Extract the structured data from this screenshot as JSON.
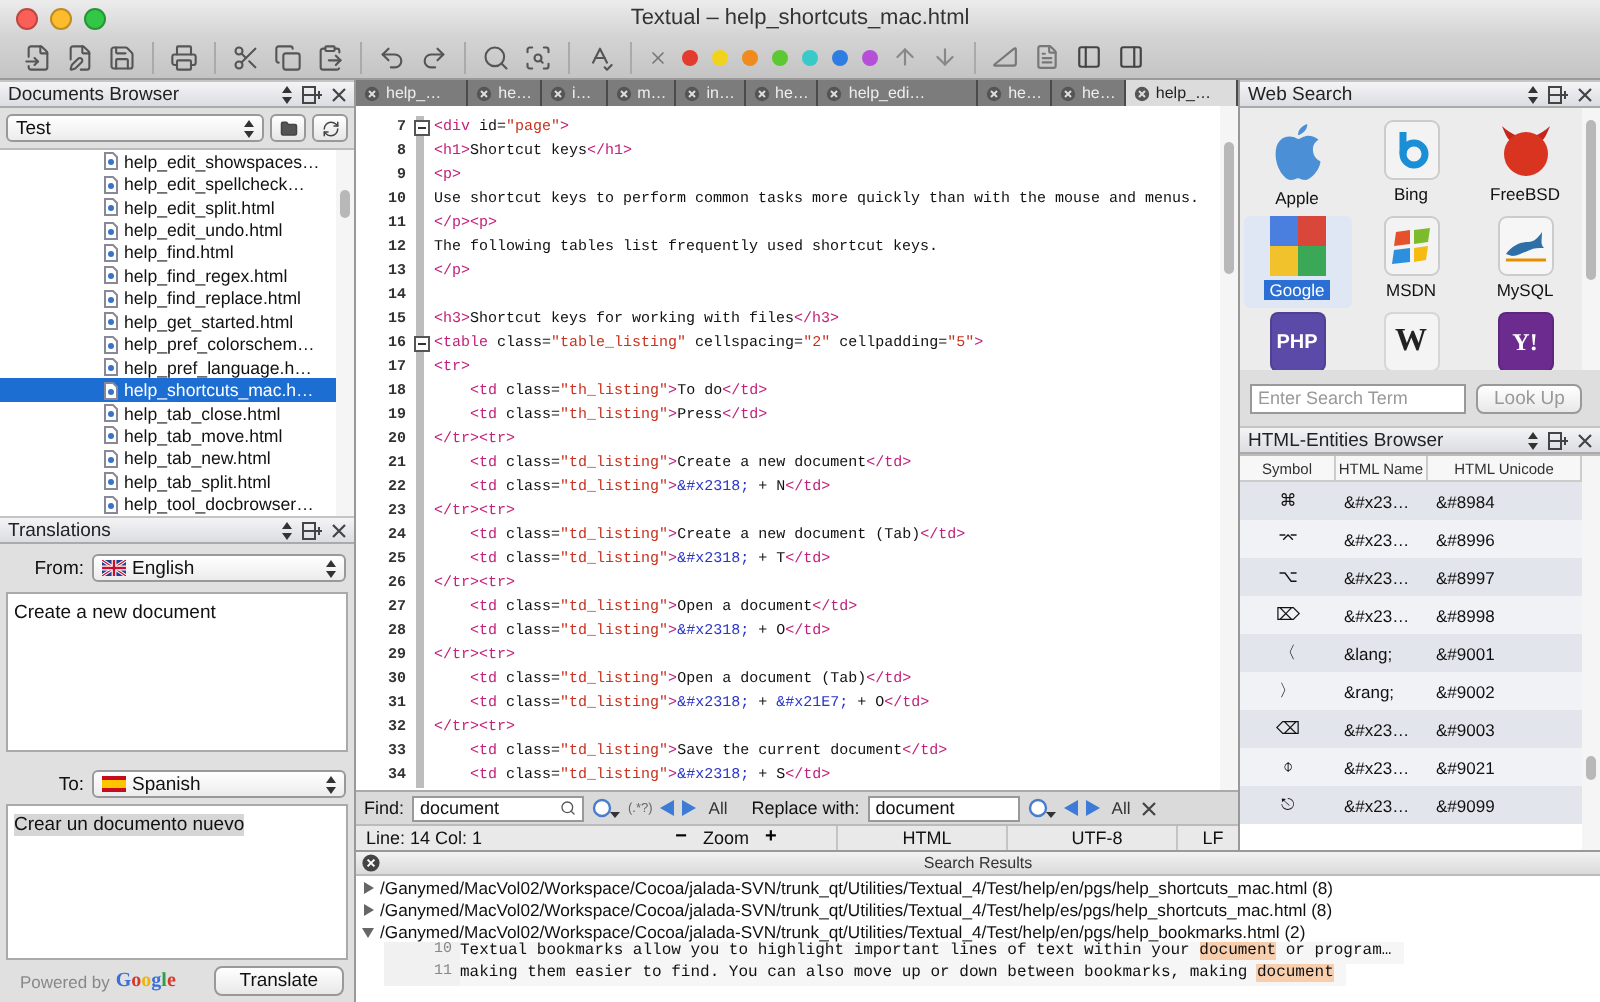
{
  "window": {
    "title": "Textual – help_shortcuts_mac.html"
  },
  "toolbar": {
    "bookmark_colors": [
      {
        "color": "#e33b2e"
      },
      {
        "color": "#f2d31b"
      },
      {
        "color": "#f08a1c"
      },
      {
        "color": "#5cc932"
      },
      {
        "color": "#38c9c9"
      },
      {
        "color": "#2f7de0"
      },
      {
        "color": "#b64fd8"
      }
    ]
  },
  "documents_browser": {
    "title": "Documents Browser",
    "folder": "Test",
    "files": [
      {
        "name": "help_edit_showspaces…",
        "selected": false
      },
      {
        "name": "help_edit_spellcheck…",
        "selected": false
      },
      {
        "name": "help_edit_split.html",
        "selected": false
      },
      {
        "name": "help_edit_undo.html",
        "selected": false
      },
      {
        "name": "help_find.html",
        "selected": false
      },
      {
        "name": "help_find_regex.html",
        "selected": false
      },
      {
        "name": "help_find_replace.html",
        "selected": false
      },
      {
        "name": "help_get_started.html",
        "selected": false
      },
      {
        "name": "help_pref_colorschem…",
        "selected": false
      },
      {
        "name": "help_pref_language.h…",
        "selected": false
      },
      {
        "name": "help_shortcuts_mac.h…",
        "selected": true
      },
      {
        "name": "help_tab_close.html",
        "selected": false
      },
      {
        "name": "help_tab_move.html",
        "selected": false
      },
      {
        "name": "help_tab_new.html",
        "selected": false
      },
      {
        "name": "help_tab_split.html",
        "selected": false
      },
      {
        "name": "help_tool_docbrowser…",
        "selected": false
      }
    ]
  },
  "translations": {
    "title": "Translations",
    "from_label": "From:",
    "from_language": "English",
    "source_text": "Create a new document",
    "to_label": "To:",
    "to_language": "Spanish",
    "result_text": "Crear un documento nuevo",
    "powered_by": "Powered by",
    "logo": "Google",
    "button": "Translate"
  },
  "tabs": [
    {
      "label": "help_…",
      "selected": false
    },
    {
      "label": "he…",
      "selected": false
    },
    {
      "label": "i…",
      "selected": false
    },
    {
      "label": "m…",
      "selected": false
    },
    {
      "label": "in…",
      "selected": false
    },
    {
      "label": "he…",
      "selected": false
    },
    {
      "label": "help_edi…",
      "selected": false
    },
    {
      "label": "he…",
      "selected": false
    },
    {
      "label": "he…",
      "selected": false
    },
    {
      "label": "help_…",
      "selected": true
    }
  ],
  "editor": {
    "lines": [
      {
        "number": "7",
        "fold": true,
        "tokens": [
          {
            "kind": "tag",
            "t": "<div"
          },
          {
            "kind": "text",
            "t": " id="
          },
          {
            "kind": "str",
            "t": "\"page\""
          },
          {
            "kind": "tag",
            "t": ">"
          }
        ]
      },
      {
        "number": "8",
        "fold": false,
        "tokens": [
          {
            "kind": "tag",
            "t": "<h1>"
          },
          {
            "kind": "text",
            "t": "Shortcut keys"
          },
          {
            "kind": "tag",
            "t": "</h1>"
          }
        ]
      },
      {
        "number": "9",
        "fold": false,
        "tokens": [
          {
            "kind": "tag",
            "t": "<p>"
          }
        ]
      },
      {
        "number": "10",
        "fold": false,
        "tokens": [
          {
            "kind": "text",
            "t": "Use shortcut keys to perform common tasks more quickly than with the mouse and menus."
          }
        ]
      },
      {
        "number": "11",
        "fold": false,
        "tokens": [
          {
            "kind": "tag",
            "t": "</p><p>"
          }
        ]
      },
      {
        "number": "12",
        "fold": false,
        "tokens": [
          {
            "kind": "text",
            "t": "The following tables list frequently used shortcut keys."
          }
        ]
      },
      {
        "number": "13",
        "fold": false,
        "tokens": [
          {
            "kind": "tag",
            "t": "</p>"
          }
        ]
      },
      {
        "number": "14",
        "fold": false
      },
      {
        "number": "15",
        "fold": false,
        "tokens": [
          {
            "kind": "tag",
            "t": "<h3>"
          },
          {
            "kind": "text",
            "t": "Shortcut keys for working with files"
          },
          {
            "kind": "tag",
            "t": "</h3>"
          }
        ]
      },
      {
        "number": "16",
        "fold": true,
        "tokens": [
          {
            "kind": "tag",
            "t": "<table"
          },
          {
            "kind": "text",
            "t": " class="
          },
          {
            "kind": "str",
            "t": "\"table_listing\""
          },
          {
            "kind": "text",
            "t": " cellspacing="
          },
          {
            "kind": "str",
            "t": "\"2\""
          },
          {
            "kind": "text",
            "t": " cellpadding="
          },
          {
            "kind": "str",
            "t": "\"5\""
          },
          {
            "kind": "tag",
            "t": ">"
          }
        ]
      },
      {
        "number": "17",
        "fold": false,
        "tokens": [
          {
            "kind": "tag",
            "t": "<tr>"
          }
        ]
      },
      {
        "number": "18",
        "fold": false,
        "tokens": [
          {
            "kind": "tag",
            "t": "    <td"
          },
          {
            "kind": "text",
            "t": " class="
          },
          {
            "kind": "str",
            "t": "\"th_listing\""
          },
          {
            "kind": "tag",
            "t": ">"
          },
          {
            "kind": "text",
            "t": "To do"
          },
          {
            "kind": "tag",
            "t": "</td>"
          }
        ]
      },
      {
        "number": "19",
        "fold": false,
        "tokens": [
          {
            "kind": "tag",
            "t": "    <td"
          },
          {
            "kind": "text",
            "t": " class="
          },
          {
            "kind": "str",
            "t": "\"th_listing\""
          },
          {
            "kind": "tag",
            "t": ">"
          },
          {
            "kind": "text",
            "t": "Press"
          },
          {
            "kind": "tag",
            "t": "</td>"
          }
        ]
      },
      {
        "number": "20",
        "fold": false,
        "tokens": [
          {
            "kind": "tag",
            "t": "</tr><tr>"
          }
        ]
      },
      {
        "number": "21",
        "fold": false,
        "tokens": [
          {
            "kind": "tag",
            "t": "    <td"
          },
          {
            "kind": "text",
            "t": " class="
          },
          {
            "kind": "str",
            "t": "\"td_listing\""
          },
          {
            "kind": "tag",
            "t": ">"
          },
          {
            "kind": "text",
            "t": "Create a new document"
          },
          {
            "kind": "tag",
            "t": "</td>"
          }
        ]
      },
      {
        "number": "22",
        "fold": false,
        "tokens": [
          {
            "kind": "tag",
            "t": "    <td"
          },
          {
            "kind": "text",
            "t": " class="
          },
          {
            "kind": "str",
            "t": "\"td_listing\""
          },
          {
            "kind": "tag",
            "t": ">"
          },
          {
            "kind": "ent",
            "t": "&#x2318;"
          },
          {
            "kind": "text",
            "t": " + N"
          },
          {
            "kind": "tag",
            "t": "</td>"
          }
        ]
      },
      {
        "number": "23",
        "fold": false,
        "tokens": [
          {
            "kind": "tag",
            "t": "</tr><tr>"
          }
        ]
      },
      {
        "number": "24",
        "fold": false,
        "tokens": [
          {
            "kind": "tag",
            "t": "    <td"
          },
          {
            "kind": "text",
            "t": " class="
          },
          {
            "kind": "str",
            "t": "\"td_listing\""
          },
          {
            "kind": "tag",
            "t": ">"
          },
          {
            "kind": "text",
            "t": "Create a new document (Tab)"
          },
          {
            "kind": "tag",
            "t": "</td>"
          }
        ]
      },
      {
        "number": "25",
        "fold": false,
        "tokens": [
          {
            "kind": "tag",
            "t": "    <td"
          },
          {
            "kind": "text",
            "t": " class="
          },
          {
            "kind": "str",
            "t": "\"td_listing\""
          },
          {
            "kind": "tag",
            "t": ">"
          },
          {
            "kind": "ent",
            "t": "&#x2318;"
          },
          {
            "kind": "text",
            "t": " + T"
          },
          {
            "kind": "tag",
            "t": "</td>"
          }
        ]
      },
      {
        "number": "26",
        "fold": false,
        "tokens": [
          {
            "kind": "tag",
            "t": "</tr><tr>"
          }
        ]
      },
      {
        "number": "27",
        "fold": false,
        "tokens": [
          {
            "kind": "tag",
            "t": "    <td"
          },
          {
            "kind": "text",
            "t": " class="
          },
          {
            "kind": "str",
            "t": "\"td_listing\""
          },
          {
            "kind": "tag",
            "t": ">"
          },
          {
            "kind": "text",
            "t": "Open a document"
          },
          {
            "kind": "tag",
            "t": "</td>"
          }
        ]
      },
      {
        "number": "28",
        "fold": false,
        "tokens": [
          {
            "kind": "tag",
            "t": "    <td"
          },
          {
            "kind": "text",
            "t": " class="
          },
          {
            "kind": "str",
            "t": "\"td_listing\""
          },
          {
            "kind": "tag",
            "t": ">"
          },
          {
            "kind": "ent",
            "t": "&#x2318;"
          },
          {
            "kind": "text",
            "t": " + O"
          },
          {
            "kind": "tag",
            "t": "</td>"
          }
        ]
      },
      {
        "number": "29",
        "fold": false,
        "tokens": [
          {
            "kind": "tag",
            "t": "</tr><tr>"
          }
        ]
      },
      {
        "number": "30",
        "fold": false,
        "tokens": [
          {
            "kind": "tag",
            "t": "    <td"
          },
          {
            "kind": "text",
            "t": " class="
          },
          {
            "kind": "str",
            "t": "\"td_listing\""
          },
          {
            "kind": "tag",
            "t": ">"
          },
          {
            "kind": "text",
            "t": "Open a document (Tab)"
          },
          {
            "kind": "tag",
            "t": "</td>"
          }
        ]
      },
      {
        "number": "31",
        "fold": false,
        "tokens": [
          {
            "kind": "tag",
            "t": "    <td"
          },
          {
            "kind": "text",
            "t": " class="
          },
          {
            "kind": "str",
            "t": "\"td_listing\""
          },
          {
            "kind": "tag",
            "t": ">"
          },
          {
            "kind": "ent",
            "t": "&#x2318;"
          },
          {
            "kind": "text",
            "t": " + "
          },
          {
            "kind": "ent",
            "t": "&#x21E7;"
          },
          {
            "kind": "text",
            "t": " + O"
          },
          {
            "kind": "tag",
            "t": "</td>"
          }
        ]
      },
      {
        "number": "32",
        "fold": false,
        "tokens": [
          {
            "kind": "tag",
            "t": "</tr><tr>"
          }
        ]
      },
      {
        "number": "33",
        "fold": false,
        "tokens": [
          {
            "kind": "tag",
            "t": "    <td"
          },
          {
            "kind": "text",
            "t": " class="
          },
          {
            "kind": "str",
            "t": "\"td_listing\""
          },
          {
            "kind": "tag",
            "t": ">"
          },
          {
            "kind": "text",
            "t": "Save the current document"
          },
          {
            "kind": "tag",
            "t": "</td>"
          }
        ]
      },
      {
        "number": "34",
        "fold": false,
        "tokens": [
          {
            "kind": "tag",
            "t": "    <td"
          },
          {
            "kind": "text",
            "t": " class="
          },
          {
            "kind": "str",
            "t": "\"td_listing\""
          },
          {
            "kind": "tag",
            "t": ">"
          },
          {
            "kind": "ent",
            "t": "&#x2318;"
          },
          {
            "kind": "text",
            "t": " + S"
          },
          {
            "kind": "tag",
            "t": "</td>"
          }
        ]
      }
    ]
  },
  "find_bar": {
    "find_label": "Find:",
    "find_value": "document",
    "regex_label": "(.*?)",
    "find_all": "All",
    "replace_label": "Replace with:",
    "replace_value": "document",
    "replace_all": "All"
  },
  "status_bar": {
    "position": "Line: 14 Col: 1",
    "zoom_out": "−",
    "zoom_label": "Zoom",
    "zoom_in": "+",
    "syntax": "HTML",
    "encoding": "UTF-8",
    "line_ending": "LF"
  },
  "web_search": {
    "title": "Web Search",
    "engines": [
      {
        "kind": "apple",
        "label": "Apple",
        "selected": false
      },
      {
        "kind": "bing",
        "label": "Bing",
        "selected": false
      },
      {
        "kind": "freebsd",
        "label": "FreeBSD",
        "selected": false
      },
      {
        "kind": "google",
        "label": "Google",
        "selected": true
      },
      {
        "kind": "msdn",
        "label": "MSDN",
        "selected": false
      },
      {
        "kind": "mysql",
        "label": "MySQL",
        "selected": false
      },
      {
        "kind": "php",
        "logo_text": "PHP",
        "selected": false
      },
      {
        "kind": "wikipedia",
        "logo_text": "W",
        "selected": false
      },
      {
        "kind": "yahoo",
        "logo_text": "Y!",
        "selected": false
      }
    ],
    "search": {
      "placeholder": "Enter Search Term"
    },
    "button": {
      "label": "Look Up",
      "disabled": true
    }
  },
  "entities": {
    "title": "HTML-Entities Browser",
    "columns": [
      "Symbol",
      "HTML Name",
      "HTML Unicode"
    ],
    "rows": [
      {
        "symbol": "⌘",
        "name": "&#x23…",
        "unicode": "&#8984"
      },
      {
        "symbol": "⌤",
        "name": "&#x23…",
        "unicode": "&#8996"
      },
      {
        "symbol": "⌥",
        "name": "&#x23…",
        "unicode": "&#8997"
      },
      {
        "symbol": "⌦",
        "name": "&#x23…",
        "unicode": "&#8998"
      },
      {
        "symbol": "〈",
        "name": "&lang;",
        "unicode": "&#9001"
      },
      {
        "symbol": "〉",
        "name": "&rang;",
        "unicode": "&#9002"
      },
      {
        "symbol": "⌫",
        "name": "&#x23…",
        "unicode": "&#9003"
      },
      {
        "symbol": "⌽",
        "name": "&#x23…",
        "unicode": "&#9021"
      },
      {
        "symbol": "⎋",
        "name": "&#x23…",
        "unicode": "&#9099"
      }
    ]
  },
  "search_results": {
    "title": "Search Results",
    "files": [
      {
        "path": "/Ganymed/MacVol02/Workspace/Cocoa/jalada-SVN/trunk_qt/Utilities/Textual_4/Test/help/en/pgs/help_shortcuts_mac.html (8)",
        "expanded": false
      },
      {
        "path": "/Ganymed/MacVol02/Workspace/Cocoa/jalada-SVN/trunk_qt/Utilities/Textual_4/Test/help/es/pgs/help_shortcuts_mac.html (8)",
        "expanded": false
      },
      {
        "path": "/Ganymed/MacVol02/Workspace/Cocoa/jalada-SVN/trunk_qt/Utilities/Textual_4/Test/help/en/pgs/help_bookmarks.html (2)",
        "expanded": true,
        "matches": [
          {
            "line": "10",
            "before": "Textual bookmarks allow you to highlight important lines of text within your ",
            "match": "document",
            "after": " or program…"
          },
          {
            "line": "11",
            "before": "making them easier to find. You can also move up or down between bookmarks, making ",
            "match": "document"
          }
        ]
      }
    ]
  }
}
